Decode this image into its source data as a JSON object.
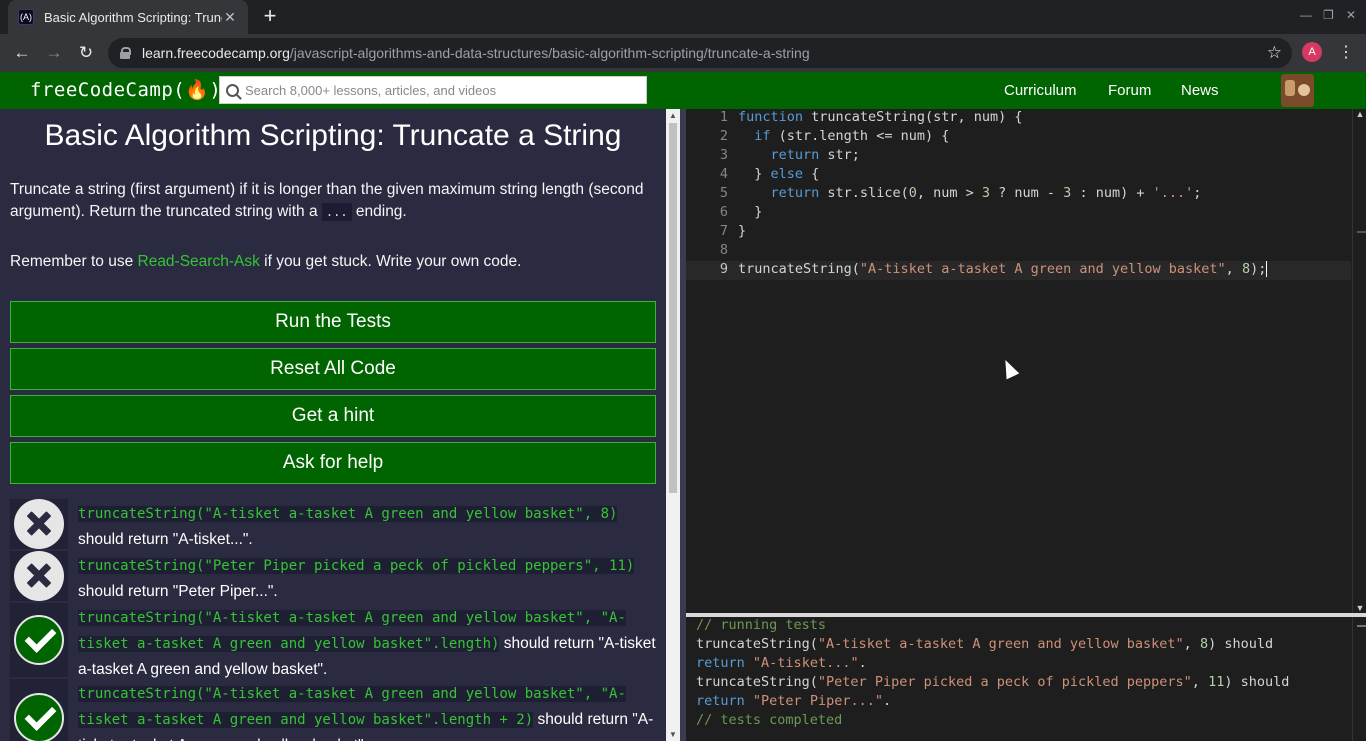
{
  "browser": {
    "tab_title": "Basic Algorithm Scripting: Trunc",
    "tab_close": "✕",
    "new_tab": "+",
    "favicon_text": "(A)",
    "url_host": "learn.freecodecamp.org",
    "url_path": "/javascript-algorithms-and-data-structures/basic-algorithm-scripting/truncate-a-string",
    "back_icon": "←",
    "forward_icon": "→",
    "reload_icon": "↻",
    "star_icon": "☆",
    "profile_initial": "A",
    "menu_icon": "⋮",
    "minimize": "—",
    "restore": "❐",
    "close": "✕"
  },
  "navbar": {
    "logo": "freeCodeCamp(🔥)",
    "search_placeholder": "Search 8,000+ lessons, articles, and videos",
    "links": [
      "Curriculum",
      "Forum",
      "News"
    ]
  },
  "challenge": {
    "title": "Basic Algorithm Scripting: Truncate a String",
    "description_part1": "Truncate a string (first argument) if it is longer than the given maximum string length (second argument). Return the truncated string with a ",
    "description_code": "...",
    "description_part2": " ending.",
    "remember_part1": "Remember to use ",
    "remember_link": "Read-Search-Ask",
    "remember_part2": " if you get stuck. Write your own code.",
    "buttons": {
      "run": "Run the Tests",
      "reset": "Reset All Code",
      "hint": "Get a hint",
      "help": "Ask for help"
    },
    "tests": [
      {
        "status": "fail",
        "code": "truncateString(\"A-tisket a-tasket A green and yellow basket\", 8)",
        "text": " should return \"A-tisket...\"."
      },
      {
        "status": "fail",
        "code": "truncateString(\"Peter Piper picked a peck of pickled peppers\", 11)",
        "text": " should return \"Peter Piper...\"."
      },
      {
        "status": "pass",
        "code": "truncateString(\"A-tisket a-tasket A green and yellow basket\", \"A-tisket a-tasket A green and yellow basket\".length)",
        "text": " should return \"A-tisket a-tasket A green and yellow basket\"."
      },
      {
        "status": "pass",
        "code": "truncateString(\"A-tisket a-tasket A green and yellow basket\", \"A-tisket a-tasket A green and yellow basket\".length + 2)",
        "text": " should return \"A-tisket a-tasket A green and yellow basket\"."
      }
    ]
  },
  "editor": {
    "line_numbers": [
      "1",
      "2",
      "3",
      "4",
      "5",
      "6",
      "7",
      "8",
      "9"
    ]
  },
  "console": {
    "lines": [
      "// running tests",
      "truncateString(\"A-tisket a-tasket A green and yellow basket\", 8) should",
      "return \"A-tisket...\".",
      "truncateString(\"Peter Piper picked a peck of pickled peppers\", 11) should",
      "return \"Peter Piper...\".",
      "// tests completed"
    ]
  },
  "colors": {
    "fcc_green": "#006400",
    "panel_bg": "#2a2a40",
    "editor_bg": "#1e1e1e",
    "link_green": "#35c435"
  }
}
